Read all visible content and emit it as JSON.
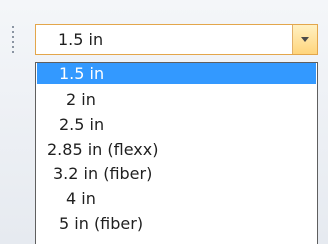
{
  "combo": {
    "value": "1.5 in"
  },
  "dropdown": {
    "items": [
      {
        "label": "1.5 in",
        "selected": true
      },
      {
        "label": "2 in",
        "selected": false
      },
      {
        "label": "2.5 in",
        "selected": false
      },
      {
        "label": "2.85 in (flexx)",
        "selected": false
      },
      {
        "label": "3.2 in (fiber)",
        "selected": false
      },
      {
        "label": "4 in",
        "selected": false
      },
      {
        "label": "5 in (fiber)",
        "selected": false
      }
    ]
  },
  "colors": {
    "selection": "#3399ff",
    "combo_border": "#e3a64b",
    "arrow_button": "#ffd57c"
  },
  "icons": {
    "grip": "toolbar-grip-icon",
    "arrow": "dropdown-arrow-icon"
  }
}
